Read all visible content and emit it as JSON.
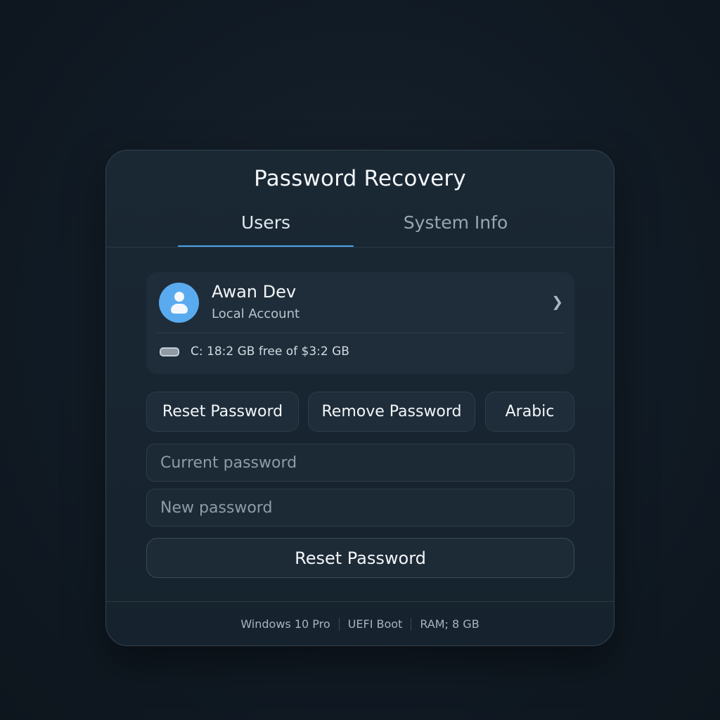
{
  "window": {
    "title": "Password Recovery"
  },
  "tabs": [
    {
      "label": "Users",
      "active": true
    },
    {
      "label": "System Info",
      "active": false
    }
  ],
  "user": {
    "name": "Awan Dev",
    "account_type": "Local Account",
    "avatar_icon": "user-icon",
    "drive": {
      "icon": "drive-icon",
      "letter": "C:",
      "text": "C:  18:2 GB free of $3:2 GB"
    },
    "chevron_icon": "chevron-right-icon"
  },
  "actions": {
    "reset_password": "Reset Password",
    "remove_password": "Remove Password",
    "language": "Arabic"
  },
  "form": {
    "current_password": {
      "placeholder": "Current password",
      "value": ""
    },
    "new_password": {
      "placeholder": "New password",
      "value": ""
    },
    "submit_label": "Reset Password"
  },
  "footer": {
    "os": "Windows 10 Pro",
    "boot": "UEFI Boot",
    "ram": "RAM;  8 GB"
  },
  "colors": {
    "accent": "#4ea3e8",
    "avatar": "#5aaaf0",
    "background": "#111b25",
    "card": "#1a2834"
  }
}
